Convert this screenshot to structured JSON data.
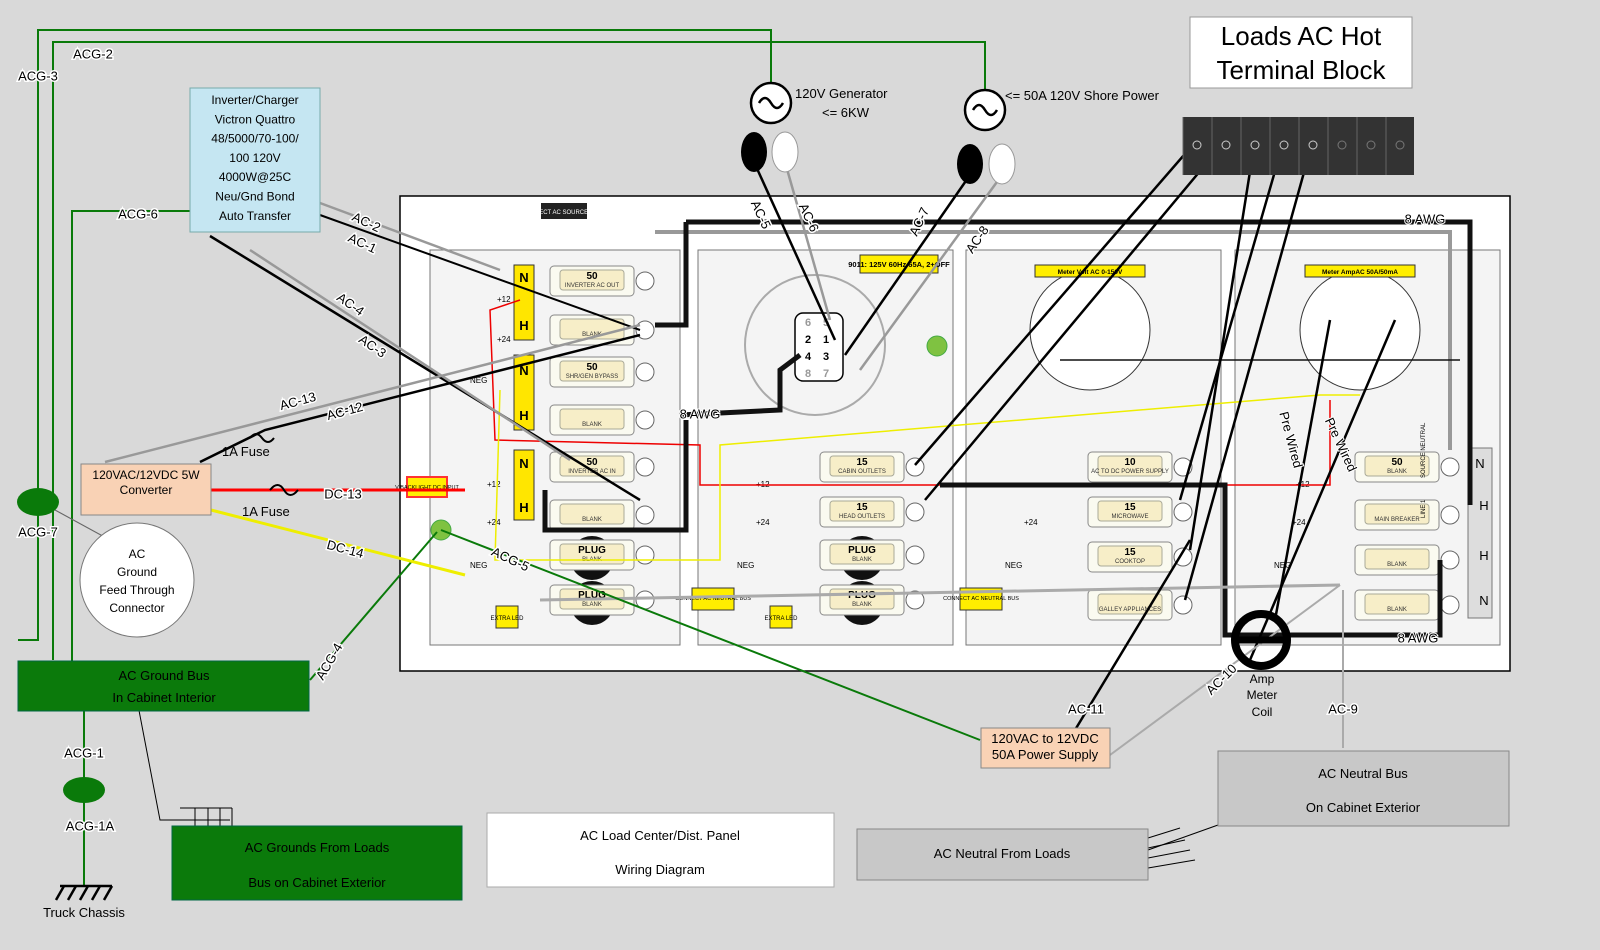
{
  "title": {
    "line1": "AC Load Center/Dist. Panel",
    "line2": "Wiring Diagram"
  },
  "hot_block": {
    "line1": "Loads AC Hot",
    "line2": "Terminal Block"
  },
  "inverter": {
    "lines": [
      "Inverter/Charger",
      "Victron Quattro",
      "48/5000/70-100/",
      "100 120V",
      "4000W@25C",
      "Neu/Gnd Bond",
      "Auto Transfer"
    ]
  },
  "generator": {
    "line1": "120V Generator",
    "line2": "<= 6KW"
  },
  "shore": {
    "label": "<= 50A 120V Shore Power"
  },
  "converter": {
    "line1": "120VAC/12VDC 5W",
    "line2": "Converter"
  },
  "fuse1": "1A Fuse",
  "fuse2": "1A Fuse",
  "feed_through": {
    "lines": [
      "AC",
      "Ground",
      "Feed Through",
      "Connector"
    ]
  },
  "ground_bus": {
    "line1": "AC Ground Bus",
    "line2": "In Cabinet Interior"
  },
  "grounds_from_loads": {
    "line1": "AC Grounds From Loads",
    "line2": "Bus on Cabinet Exterior"
  },
  "truck_chassis": "Truck Chassis",
  "power_supply": {
    "line1": "120VAC to 12VDC",
    "line2": "50A Power Supply"
  },
  "neutral_bus": {
    "line1": "AC Neutral Bus",
    "line2": "On Cabinet Exterior"
  },
  "neutral_from_loads": "AC Neutral From Loads",
  "amp_coil": {
    "lines": [
      "Amp",
      "Meter",
      "Coil"
    ]
  },
  "wire_labels": {
    "acg1": "ACG-1",
    "acg1a": "ACG-1A",
    "acg2": "ACG-2",
    "acg3": "ACG-3",
    "acg4": "ACG-4",
    "acg5": "ACG-5",
    "acg6": "ACG-6",
    "acg7": "ACG-7",
    "ac1": "AC-1",
    "ac2": "AC-2",
    "ac3": "AC-3",
    "ac4": "AC-4",
    "ac5": "AC-5",
    "ac6": "AC-6",
    "ac7": "AC-7",
    "ac8": "AC-8",
    "ac9": "AC-9",
    "ac10": "AC-10",
    "ac11": "AC-11",
    "ac12": "AC-12",
    "ac13": "AC-13",
    "dc13": "DC-13",
    "dc14": "DC-14",
    "awg_top": "8 AWG",
    "awg_mid": "8 AWG",
    "awg_bot": "8 AWG",
    "prewired1": "Pre Wired",
    "prewired2": "Pre Wired"
  },
  "panel": {
    "connect_source": "CONNECT AC SOURCE HERE",
    "selector_label": "9011: 125V 60Hz 65A, 2+OFF",
    "selector_positions": [
      "6",
      "5",
      "2",
      "1",
      "4",
      "3",
      "8",
      "7"
    ],
    "volt_meter": "Meter Volt AC 0-150V",
    "amp_meter": "Meter AmpAC 50A/50mA",
    "backlight": "V BACKLIGHT DC INPUT",
    "connect_neutral": "CONNECT AC NEUTRAL BUS",
    "extra_led": "EXTRA LED",
    "bus_n": "N",
    "bus_h": "H",
    "plus12": "+12",
    "plus24": "+24",
    "neg": "NEG",
    "source_neutral": "SOURCE NEUTRAL",
    "line1": "LINE 1",
    "breakers": [
      {
        "rating": "50",
        "name": "INVERTER AC OUT"
      },
      {
        "rating": "",
        "name": "BLANK"
      },
      {
        "rating": "50",
        "name": "SHR/GEN BYPASS"
      },
      {
        "rating": "",
        "name": "BLANK"
      },
      {
        "rating": "50",
        "name": "INVERTER AC IN"
      },
      {
        "rating": "",
        "name": "BLANK"
      },
      {
        "rating": "PLUG",
        "name": "BLANK"
      },
      {
        "rating": "PLUG",
        "name": "BLANK"
      },
      {
        "rating": "15",
        "name": "CABIN OUTLETS"
      },
      {
        "rating": "15",
        "name": "HEAD OUTLETS"
      },
      {
        "rating": "PLUG",
        "name": "BLANK"
      },
      {
        "rating": "PLUG",
        "name": "BLANK"
      },
      {
        "rating": "10",
        "name": "AC TO DC POWER SUPPLY"
      },
      {
        "rating": "15",
        "name": "MICROWAVE"
      },
      {
        "rating": "15",
        "name": "COOKTOP"
      },
      {
        "rating": "",
        "name": "GALLEY APPLIANCES"
      },
      {
        "rating": "50",
        "name": "BLANK"
      },
      {
        "rating": "",
        "name": "MAIN BREAKER"
      },
      {
        "rating": "",
        "name": "BLANK"
      },
      {
        "rating": "",
        "name": "BLANK"
      }
    ]
  },
  "colors": {
    "ground": "#0a7a0a",
    "ground_box": "#0b7a0b",
    "inverter": "#c5e6f2",
    "converter": "#f9d2b5",
    "neutral_box": "#c8c8c8",
    "label_yellow": "#ffee00",
    "dc_pos": "#ff0000",
    "dc_neg": "#ffff33"
  }
}
